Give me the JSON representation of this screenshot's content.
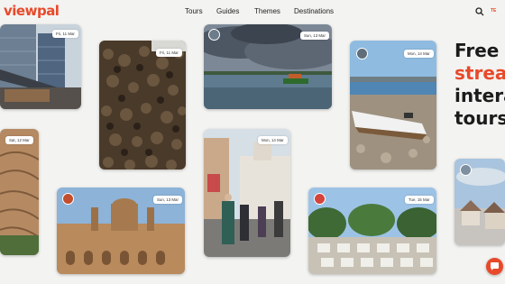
{
  "brand": {
    "logo": "viewpal",
    "accent": "#e8492a"
  },
  "nav": {
    "items": [
      "Tours",
      "Guides",
      "Themes",
      "Destinations"
    ]
  },
  "header": {
    "language": "TE"
  },
  "hero": {
    "line1_a": "Free ",
    "line1_b": "l",
    "line2": "strea",
    "line3": "intera",
    "line4": "tours"
  },
  "cards": [
    {
      "date": "Fri, 11 Mar",
      "scene": "modern glass office building"
    },
    {
      "date": "Fri, 11 Mar",
      "scene": "market snails"
    },
    {
      "date": "Sun, 13 Mar",
      "scene": "storm clouds over lake with boat"
    },
    {
      "date": "Mon, 14 Mar",
      "scene": "rowboat on rocky shore"
    },
    {
      "date": "Sat, 12 Mar",
      "scene": "carved wood"
    },
    {
      "date": "Mon, 14 Mar",
      "scene": "street scene with people"
    },
    {
      "date": "Sun, 13 Mar",
      "scene": "desert adobe palace"
    },
    {
      "date": "Tue, 15 Mar",
      "scene": "cemetery with trees"
    },
    {
      "date": "",
      "scene": "village with sky"
    }
  ]
}
